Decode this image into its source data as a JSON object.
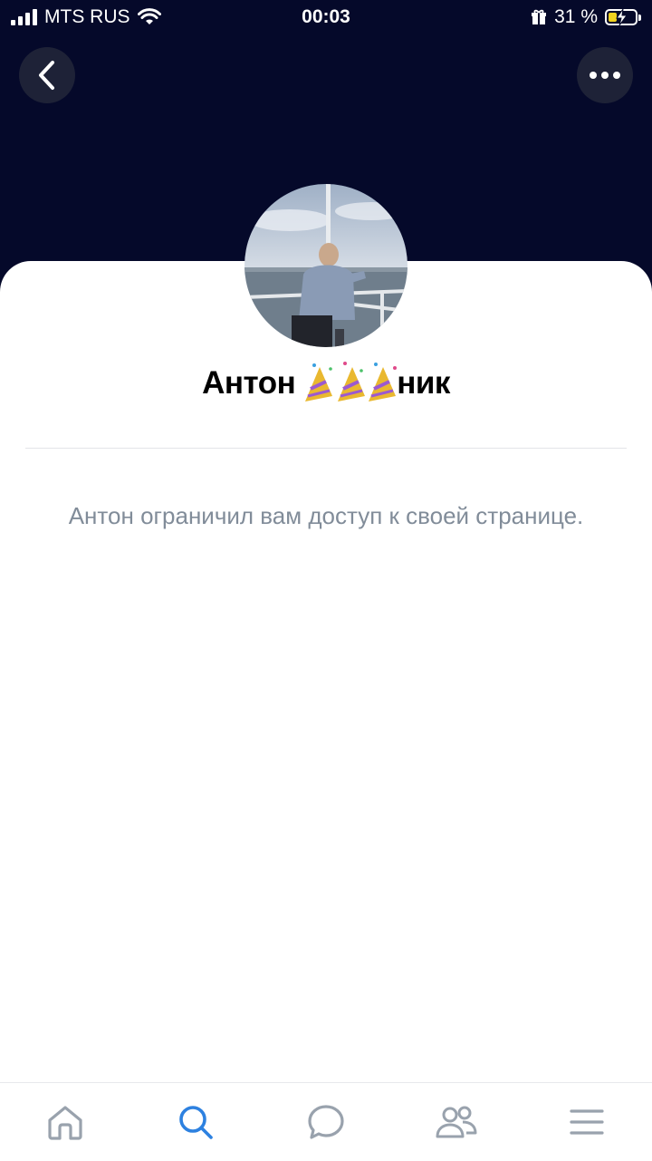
{
  "status_bar": {
    "carrier": "MTS RUS",
    "time": "00:03",
    "battery_percent": "31 %",
    "battery_level": 0.31
  },
  "header": {
    "background_color": "#05092a",
    "back_icon": "chevron-left-icon",
    "more_icon": "more-horizontal-icon"
  },
  "profile": {
    "name_visible_first": "Антон",
    "name_visible_end": "ник",
    "restricted_message": "Антон ограничил вам доступ к своей странице."
  },
  "tab_bar": {
    "active_color": "#2d81e0",
    "inactive_color": "#99a2ad",
    "items": [
      {
        "icon": "home-icon",
        "active": false
      },
      {
        "icon": "search-icon",
        "active": true
      },
      {
        "icon": "messages-icon",
        "active": false
      },
      {
        "icon": "friends-icon",
        "active": false
      },
      {
        "icon": "menu-icon",
        "active": false
      }
    ]
  }
}
